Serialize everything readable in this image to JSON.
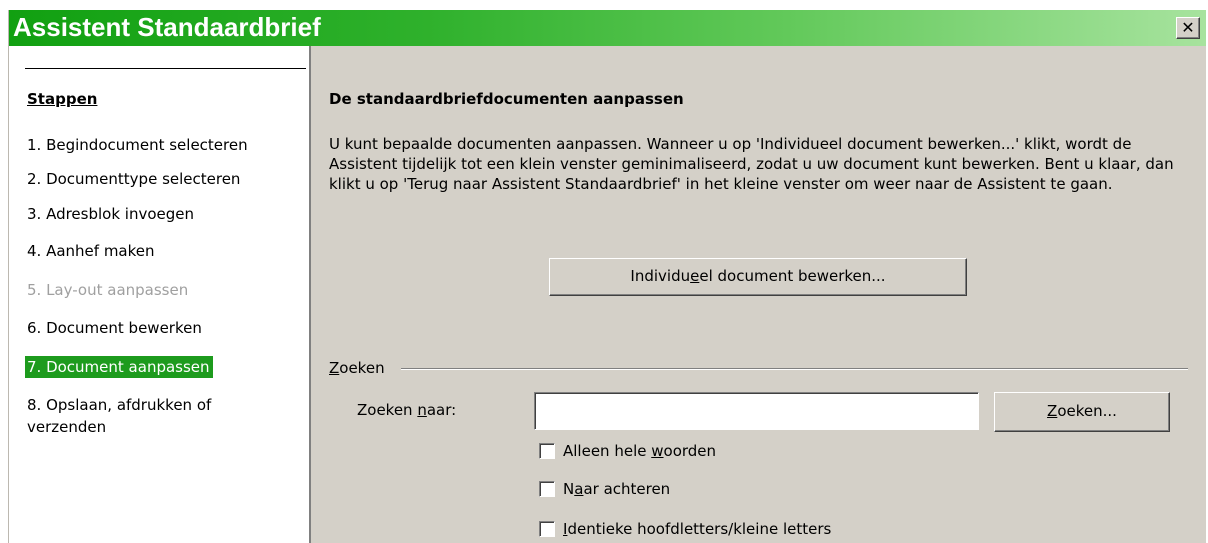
{
  "window": {
    "title": "Assistent Standaardbrief",
    "close_glyph": "✕"
  },
  "sidebar": {
    "heading": "Stappen",
    "steps": [
      {
        "label": "1. Begindocument selecteren",
        "state": "normal"
      },
      {
        "label": "2. Documenttype selecteren",
        "state": "normal"
      },
      {
        "label": "3. Adresblok invoegen",
        "state": "normal"
      },
      {
        "label": "4. Aanhef maken",
        "state": "normal"
      },
      {
        "label": "5. Lay-out aanpassen",
        "state": "disabled"
      },
      {
        "label": "6. Document bewerken",
        "state": "normal"
      },
      {
        "label": "7. Document aanpassen",
        "state": "active"
      },
      {
        "label": "8. Opslaan, afdrukken of verzenden",
        "state": "normal"
      }
    ]
  },
  "main": {
    "heading": "De standaardbriefdocumenten aanpassen",
    "description": "U kunt bepaalde documenten aanpassen. Wanneer u op 'Individueel document bewerken...' klikt, wordt de Assistent tijdelijk tot een klein venster geminimaliseerd, zodat u uw document kunt bewerken. Bent u klaar, dan klikt u op 'Terug naar Assistent Standaardbrief' in het kleine venster om weer naar de Assistent te gaan.",
    "edit_button": {
      "pre": "Individu",
      "mnemonic": "e",
      "post": "el document bewerken..."
    },
    "find": {
      "group": {
        "mnemonic": "Z",
        "post": "oeken"
      },
      "label": {
        "pre": "Zoeken ",
        "mnemonic": "n",
        "post": "aar:"
      },
      "input_value": "",
      "button": {
        "mnemonic": "Z",
        "post": "oeken..."
      },
      "options": [
        {
          "pre": "Alleen hele ",
          "mnemonic": "w",
          "post": "oorden",
          "checked": false
        },
        {
          "pre": "N",
          "mnemonic": "a",
          "post": "ar achteren",
          "checked": false
        },
        {
          "pre": "",
          "mnemonic": "I",
          "post": "dentieke hoofdletters/kleine letters",
          "checked": false
        }
      ]
    }
  },
  "colors": {
    "title_start": "#11a011",
    "title_end": "#a7e39e",
    "dialog_bg": "#d4d0c8",
    "selection": "#1d9b1d"
  },
  "icons": {
    "close": "close-icon"
  }
}
